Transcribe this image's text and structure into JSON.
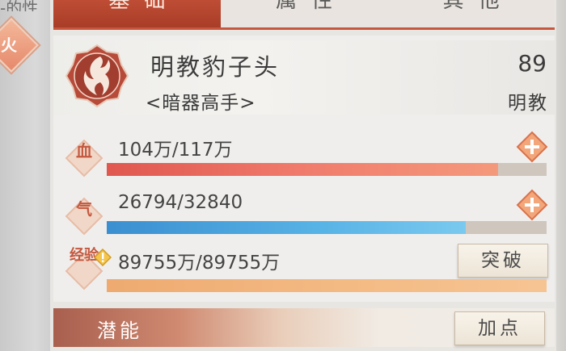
{
  "left_panel": {
    "fragment_text": "-的性",
    "element_char": "火"
  },
  "tabs": [
    {
      "label": "基础",
      "active": true
    },
    {
      "label": "属性",
      "active": false
    },
    {
      "label": "其他",
      "active": false
    }
  ],
  "hero": {
    "name": "明教豹子头",
    "level": "89",
    "title": "<暗器高手>",
    "school": "明教",
    "emblem_icon": "flame-emblem-icon"
  },
  "stats": {
    "hp": {
      "label": "血",
      "text": "104万/117万",
      "progress": 0.89
    },
    "mp": {
      "label": "气",
      "text": "26794/32840",
      "progress": 0.816
    },
    "xp": {
      "label": "经验",
      "text": "89755万/89755万",
      "progress": 1.0,
      "action": "突破"
    }
  },
  "bottom": {
    "label": "潜能",
    "action": "加点"
  },
  "colors": {
    "accent": "#c6573e",
    "hp_bar": "#ee6a5e",
    "mp_bar": "#4fa6de",
    "xp_bar": "#f2b47c"
  }
}
